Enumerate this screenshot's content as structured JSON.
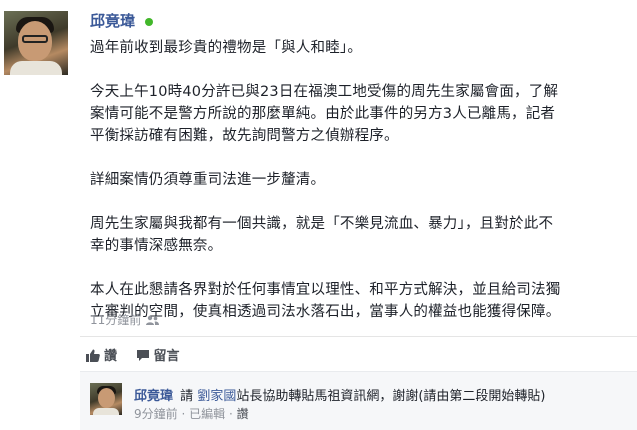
{
  "post": {
    "author": "邱竟瑋",
    "paragraphs": [
      "過年前收到最珍貴的禮物是「與人和睦」。",
      "今天上午10時40分許已與23日在福澳工地受傷的周先生家屬會面，了解\n案情可能不是警方所說的那麼單純。由於此事件的另方3人已離馬，記者\n平衡採訪確有困難，故先詢問警方之偵辦程序。",
      "詳細案情仍須尊重司法進一步釐清。",
      "周先生家屬與我都有一個共識，就是「不樂見流血、暴力」，且對於此不\n幸的事情深感無奈。",
      "本人在此懇請各界對於任何事情宜以理性、和平方式解決，並且給司法獨\n立審判的空間，使真相透過司法水落石出，當事人的權益也能獲得保障。"
    ],
    "time": "11分鐘前",
    "privacy_icon": "friends-icon"
  },
  "actions": {
    "like_label": "讚",
    "comment_label": "留言"
  },
  "comment": {
    "author": "邱竟瑋",
    "prefix": "請",
    "mention": "劉家國",
    "text": "站長協助轉貼馬祖資訊網，謝謝(請由第二段開始轉貼)",
    "time": "9分鐘前",
    "edited": "已編輯",
    "like": "讚"
  },
  "colors": {
    "link": "#3b5998",
    "online": "#42b72a",
    "meta": "#90949c"
  }
}
